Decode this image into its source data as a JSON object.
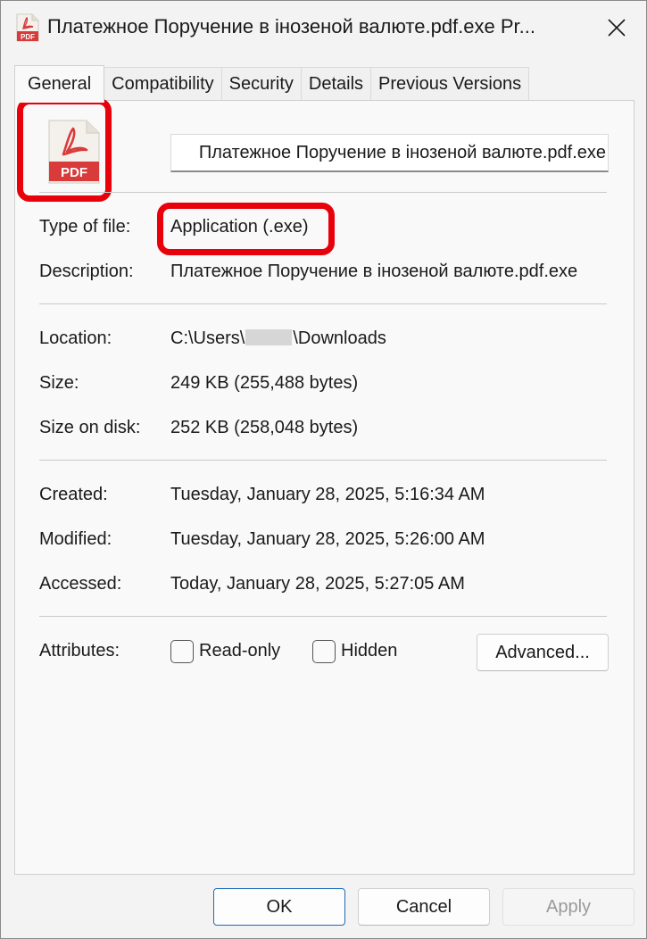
{
  "window": {
    "title": "Платежное Поручение в iнозеной валюте.pdf.exe Pr...",
    "close_glyph": "✕"
  },
  "tabs": [
    {
      "label": "General",
      "active": true
    },
    {
      "label": "Compatibility",
      "active": false
    },
    {
      "label": "Security",
      "active": false
    },
    {
      "label": "Details",
      "active": false
    },
    {
      "label": "Previous Versions",
      "active": false
    }
  ],
  "file": {
    "icon": "pdf-file-icon",
    "icon_text": "PDF",
    "name": "Платежное Поручение в iнозеной валюте.pdf.exe"
  },
  "properties": {
    "type_label": "Type of file:",
    "type_value": "Application (.exe)",
    "description_label": "Description:",
    "description_value": "Платежное Поручение в iнозеной валюте.pdf.exe",
    "location_label": "Location:",
    "location_prefix": "C:\\Users\\",
    "location_suffix": "\\Downloads",
    "size_label": "Size:",
    "size_value": "249 KB (255,488 bytes)",
    "size_on_disk_label": "Size on disk:",
    "size_on_disk_value": "252 KB (258,048 bytes)",
    "created_label": "Created:",
    "created_value": "Tuesday, January 28, 2025, 5:16:34 AM",
    "modified_label": "Modified:",
    "modified_value": "Tuesday, January 28, 2025, 5:26:00 AM",
    "accessed_label": "Accessed:",
    "accessed_value": "Today, January 28, 2025, 5:27:05 AM"
  },
  "attributes": {
    "label": "Attributes:",
    "readonly_label": "Read-only",
    "readonly_checked": false,
    "hidden_label": "Hidden",
    "hidden_checked": false,
    "advanced_label": "Advanced..."
  },
  "buttons": {
    "ok": "OK",
    "cancel": "Cancel",
    "apply": "Apply"
  },
  "colors": {
    "highlight": "#e8000b",
    "pdf_red": "#d93a3a",
    "primary_border": "#1e6bb8"
  }
}
